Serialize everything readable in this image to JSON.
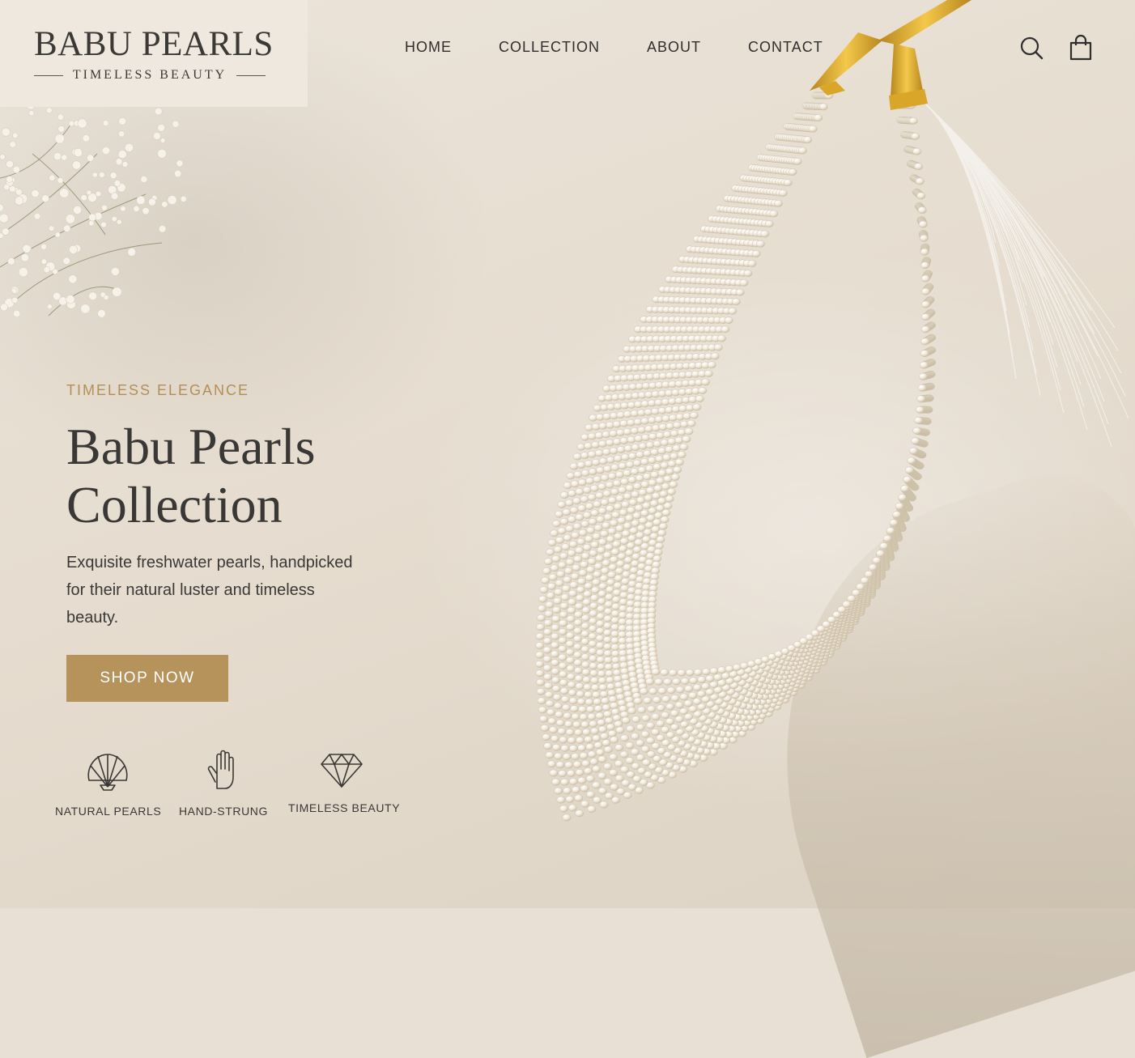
{
  "brand": {
    "name": "BABU PEARLS",
    "tagline": "TIMELESS BEAUTY"
  },
  "nav": {
    "items": [
      {
        "label": "HOME"
      },
      {
        "label": "COLLECTION"
      },
      {
        "label": "ABOUT"
      },
      {
        "label": "CONTACT"
      }
    ],
    "icons": [
      "search-icon",
      "shopping-bag-icon"
    ]
  },
  "hero": {
    "eyebrow": "TIMELESS ELEGANCE",
    "title_line1": "Babu Pearls",
    "title_line2": "Collection",
    "description": "Exquisite freshwater pearls, handpicked for their natural luster and timeless beauty.",
    "cta_label": "SHOP NOW"
  },
  "features": [
    {
      "icon": "shell-icon",
      "label": "NATURAL PEARLS"
    },
    {
      "icon": "hand-icon",
      "label": "HAND-STRUNG"
    },
    {
      "icon": "diamond-icon",
      "label": "TIMELESS BEAUTY"
    }
  ],
  "colors": {
    "accent": "#b5935a",
    "eyebrow": "#b48f55",
    "background": "#e8e0d4",
    "text": "#3a3836",
    "gold_cap": "#d9a629"
  }
}
